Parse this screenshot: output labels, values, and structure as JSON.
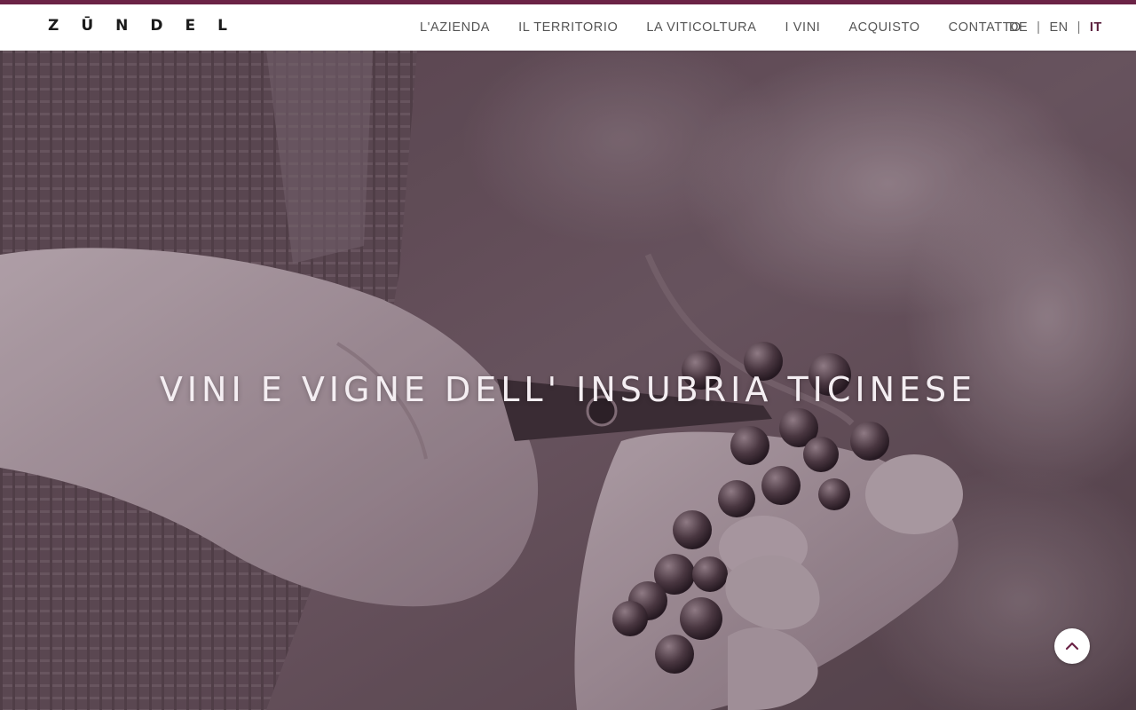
{
  "brand": {
    "logo_letters": [
      "Z",
      "Ū",
      "N",
      "D",
      "E",
      "L"
    ]
  },
  "nav": {
    "items": [
      {
        "label": "L'AZIENDA"
      },
      {
        "label": "IL TERRITORIO"
      },
      {
        "label": "LA VITICOLTURA"
      },
      {
        "label": "I VINI"
      },
      {
        "label": "ACQUISTO"
      },
      {
        "label": "CONTATTO"
      }
    ]
  },
  "languages": {
    "items": [
      {
        "code": "DE",
        "active": false
      },
      {
        "code": "EN",
        "active": false
      },
      {
        "code": "IT",
        "active": true
      }
    ],
    "separator": "|"
  },
  "hero": {
    "title": "VINI E VIGNE DELL' INSUBRIA TICINESE"
  },
  "scroll_top": {
    "icon": "chevron-up-icon"
  },
  "colors": {
    "accent": "#6b2346",
    "hero_tint": "#4b3a42",
    "active_lang": "#5a1e3c"
  }
}
